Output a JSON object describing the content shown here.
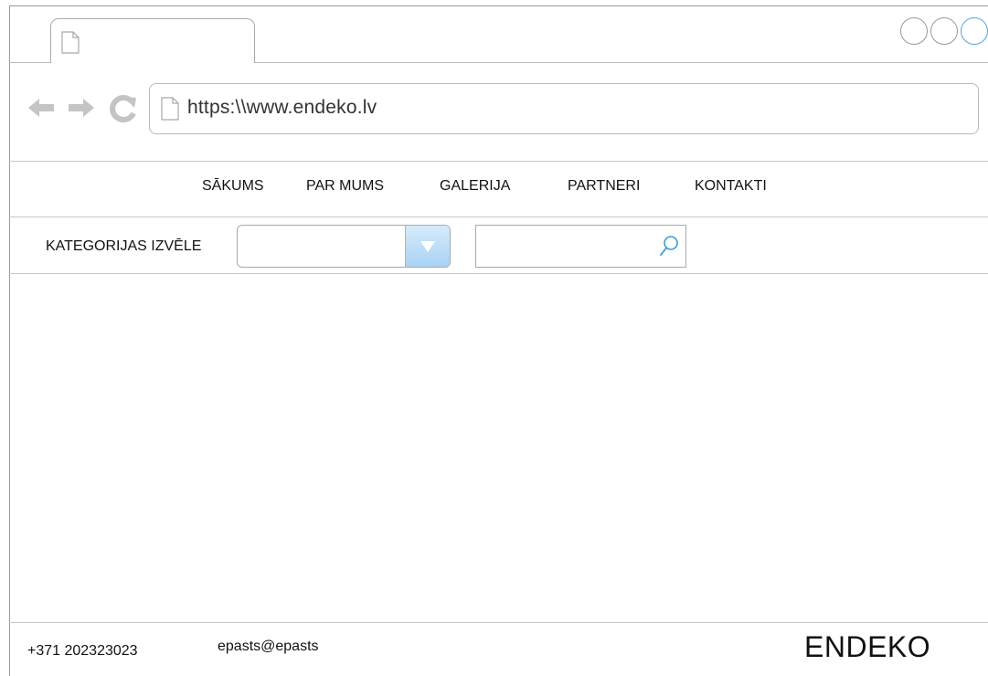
{
  "browser": {
    "url": "https:\\\\www.endeko.lv",
    "icons": {
      "back": "back-arrow-icon",
      "forward": "forward-arrow-icon",
      "reload": "reload-icon",
      "page": "document-icon"
    }
  },
  "nav": {
    "items": [
      {
        "label": "SĀKUMS"
      },
      {
        "label": "PAR MUMS"
      },
      {
        "label": "GALERIJA"
      },
      {
        "label": "PARTNERI"
      },
      {
        "label": "KONTAKTI"
      }
    ]
  },
  "filters": {
    "category_label": "KATEGORIJAS IZVĒLE",
    "category_value": "",
    "search_value": ""
  },
  "footer": {
    "phone": "+371 202323023",
    "email": "epasts@epasts",
    "brand": "ENDEKO"
  },
  "colors": {
    "accent": "#4aa8e0",
    "dropdown_button": "#a9d2f3",
    "border": "#a9a9a9"
  }
}
